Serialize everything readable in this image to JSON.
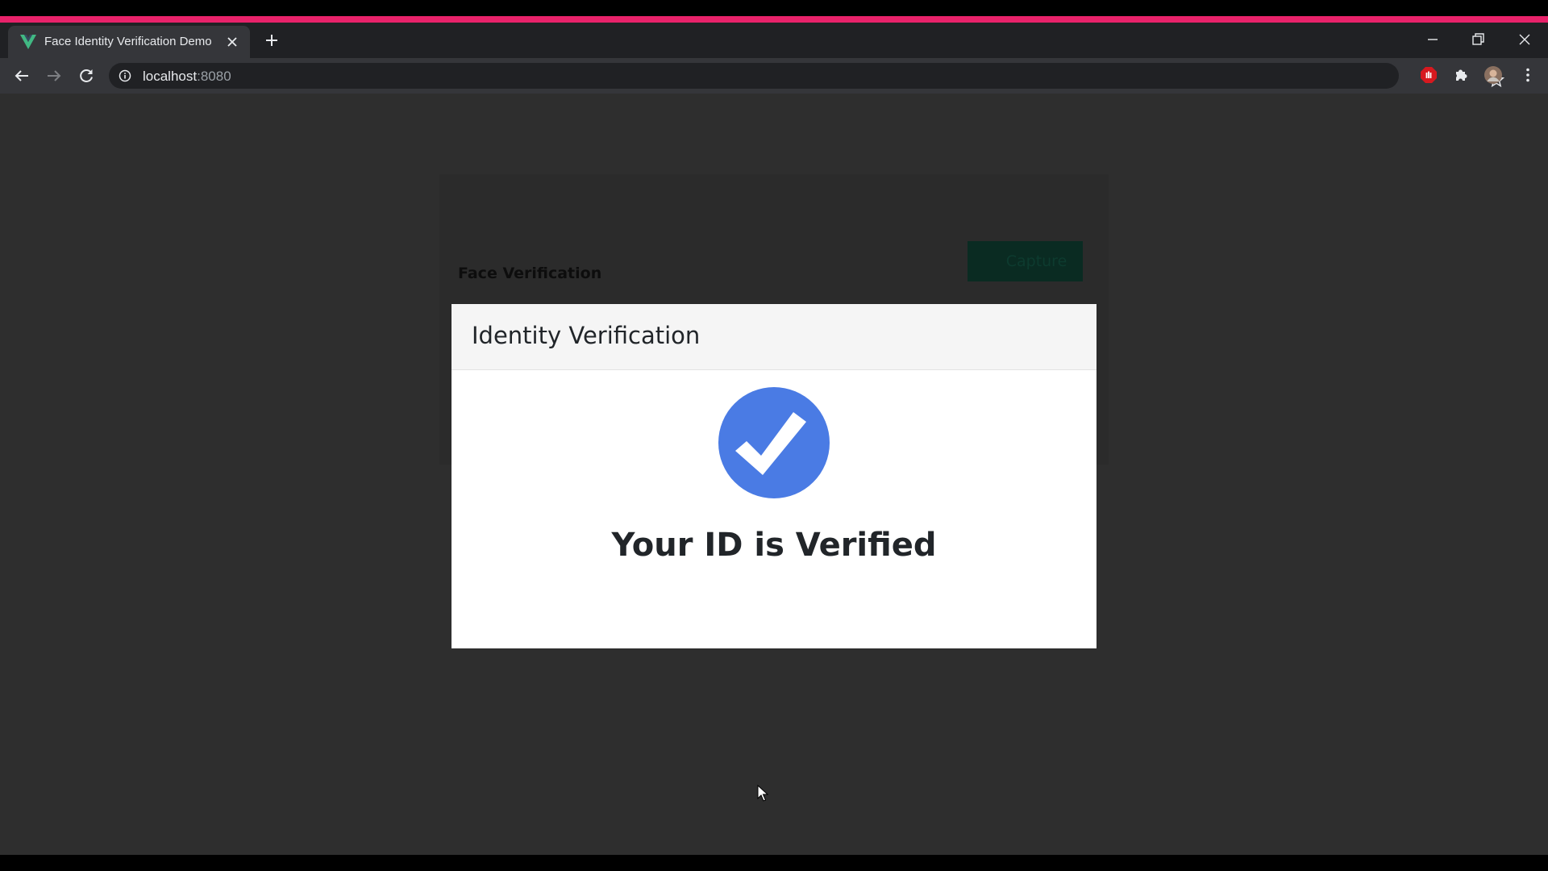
{
  "browser": {
    "tab_title": "Face Identity Verification Demo",
    "url_host": "localhost",
    "url_port": ":8080",
    "accent_color": "#e8226a"
  },
  "page": {
    "card_title": "Face Verification",
    "capture_label": "Capture"
  },
  "modal": {
    "title": "Identity Verification",
    "message": "Your ID is Verified",
    "check_color": "#4a7be4"
  },
  "icons": [
    "vue-logo-icon",
    "close-icon",
    "plus-icon",
    "minimize-icon",
    "restore-icon",
    "back-icon",
    "forward-icon",
    "reload-icon",
    "info-icon",
    "star-icon",
    "adblock-icon",
    "puzzle-icon",
    "avatar",
    "more-vert-icon",
    "check-circle-icon",
    "cursor-icon"
  ]
}
